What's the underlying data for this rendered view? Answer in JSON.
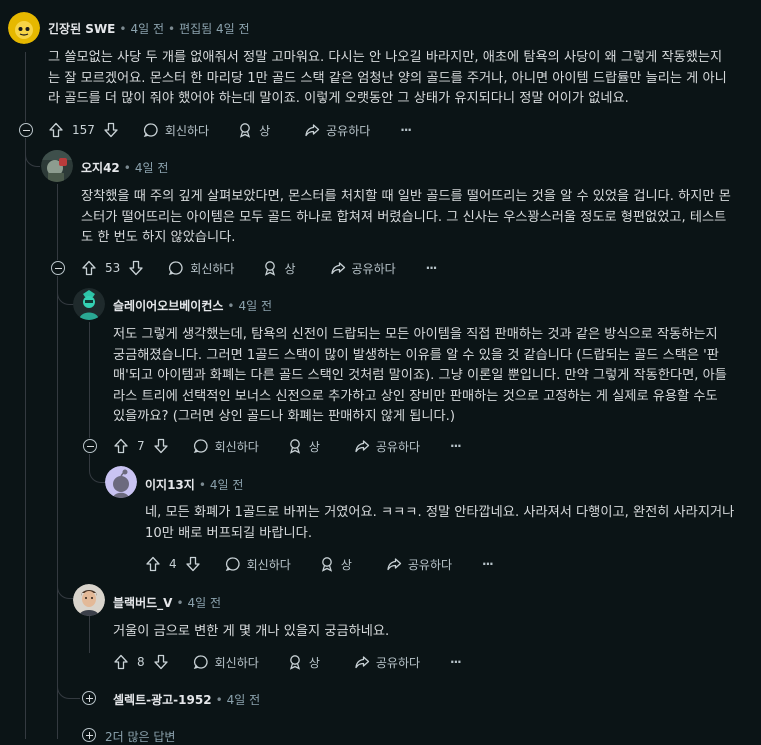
{
  "comments": [
    {
      "author": "긴장된 SWE",
      "time": "4일 전",
      "edited": "편집됨 4일 전",
      "body": "그 쓸모없는 사당 두 개를 없애줘서 정말 고마워요. 다시는 안 나오길 바라지만, 애초에 탐욕의 사당이 왜 그렇게 작동했는지는 잘 모르겠어요. 몬스터 한 마리당 1만 골드 스택 같은 엄청난 양의 골드를 주거나, 아니면 아이템 드랍률만 늘리는 게 아니라 골드를 더 많이 줘야 했어야 하는데 말이죠. 이렇게 오랫동안 그 상태가 유지되다니 정말 어이가 없네요.",
      "votes": "157"
    },
    {
      "author": "오지42",
      "time": "4일 전",
      "body": "장착했을 때 주의 깊게 살펴보았다면, 몬스터를 처치할 때 일반 골드를 떨어뜨리는 것을 알 수 있었을 겁니다. 하지만 몬스터가 떨어뜨리는 아이템은 모두 골드 하나로 합쳐져 버렸습니다. 그 신사는 우스꽝스러울 정도로 형편없었고, 테스트도 한 번도 하지 않았습니다.",
      "votes": "53"
    },
    {
      "author": "슬레이어오브베이컨스",
      "time": "4일 전",
      "body": "저도 그렇게 생각했는데, 탐욕의 신전이 드랍되는 모든 아이템을 직접 판매하는 것과 같은 방식으로 작동하는지 궁금해졌습니다. 그러면 1골드 스택이 많이 발생하는 이유를 알 수 있을 것 같습니다 (드랍되는 골드 스택은 '판매'되고 아이템과 화폐는 다른 골드 스택인 것처럼 말이죠). 그냥 이론일 뿐입니다. 만약 그렇게 작동한다면, 아틀라스 트리에 선택적인 보너스 신전으로 추가하고 상인 장비만 판매하는 것으로 고정하는 게 실제로 유용할 수도 있을까요? (그러면 상인 골드나 화폐는 판매하지 않게 됩니다.)",
      "votes": "7"
    },
    {
      "author": "이지13지",
      "time": "4일 전",
      "body": "네, 모든 화폐가 1골드로 바뀌는 거였어요. ㅋㅋㅋ. 정말 안타깝네요. 사라져서 다행이고, 완전히 사라지거나 10만 배로 버프되길 바랍니다.",
      "votes": "4"
    },
    {
      "author": "블랙버드_V",
      "time": "4일 전",
      "body": "거울이 금으로 변한 게 몇 개나 있을지 궁금하네요.",
      "votes": "8"
    },
    {
      "author": "셀렉트-광고-1952",
      "time": "4일 전"
    }
  ],
  "labels": {
    "reply": "회신하다",
    "award": "상",
    "share": "공유하다",
    "more": "···",
    "more_replies": "2더 많은 답변",
    "dot": "•"
  },
  "colors": {
    "background": "#0b1416",
    "text": "#d7dadc",
    "muted": "#8ba2ad",
    "line": "#343a40"
  }
}
